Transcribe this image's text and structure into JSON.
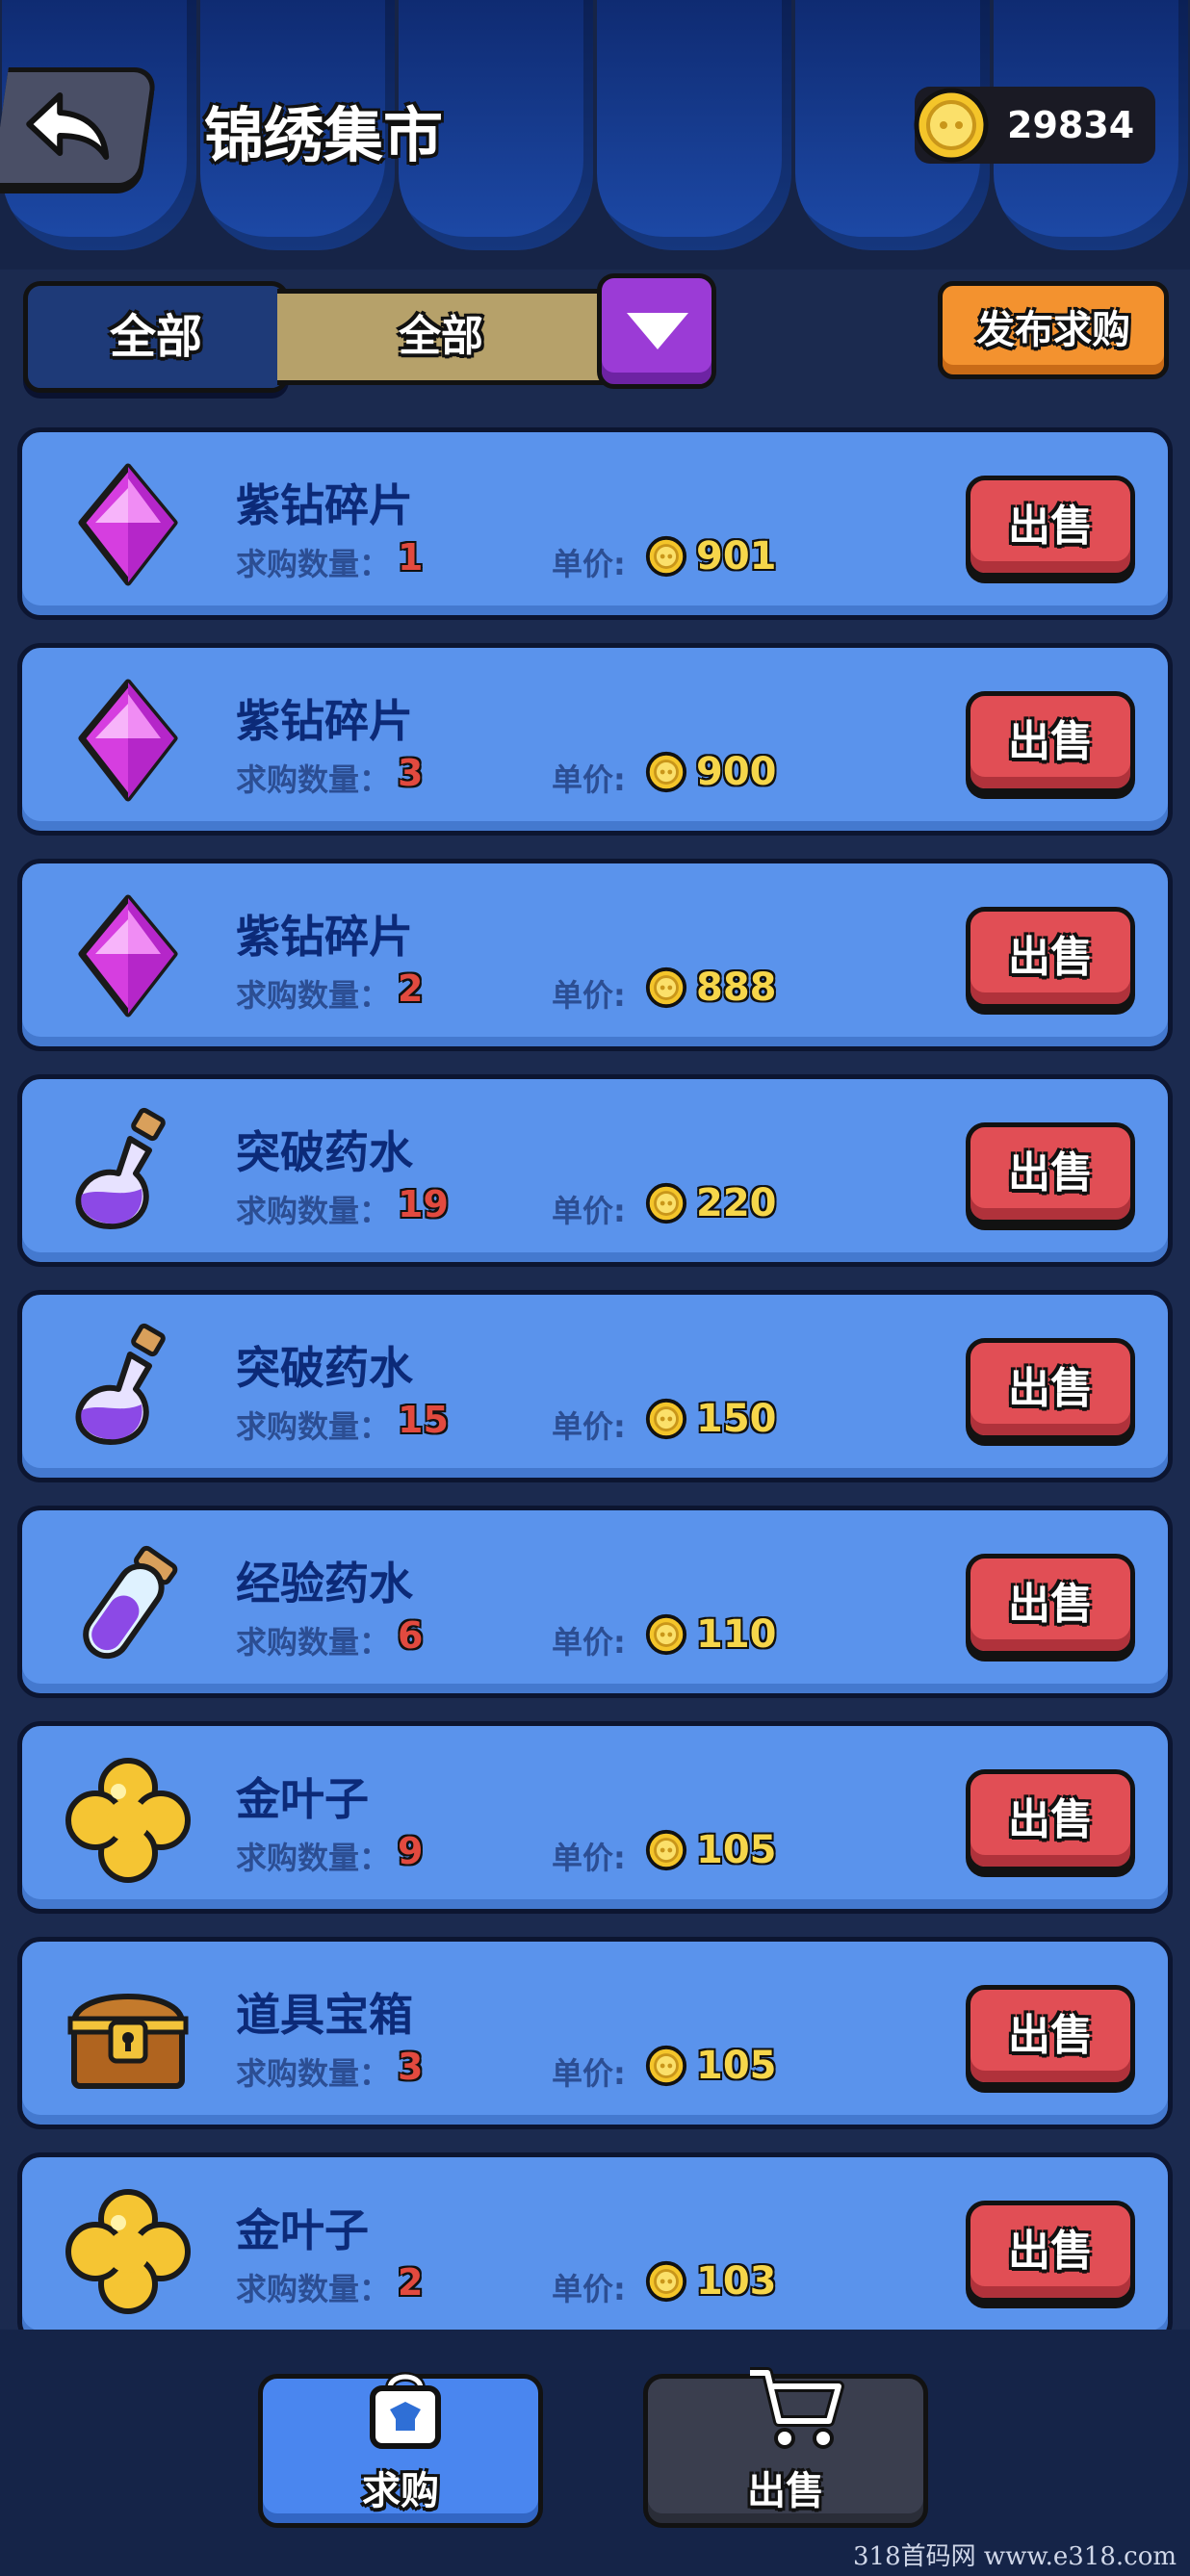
{
  "header": {
    "title": "锦绣集市",
    "coins": "29834"
  },
  "filter": {
    "category": "全部",
    "subcategory": "全部",
    "publish_label": "发布求购"
  },
  "labels": {
    "quantity": "求购数量：",
    "price": "单价:",
    "sell": "出售"
  },
  "items": [
    {
      "name": "紫钻碎片",
      "qty": "1",
      "price": "901",
      "icon": "purple-diamond"
    },
    {
      "name": "紫钻碎片",
      "qty": "3",
      "price": "900",
      "icon": "purple-diamond"
    },
    {
      "name": "紫钻碎片",
      "qty": "2",
      "price": "888",
      "icon": "purple-diamond"
    },
    {
      "name": "突破药水",
      "qty": "19",
      "price": "220",
      "icon": "potion-flask"
    },
    {
      "name": "突破药水",
      "qty": "15",
      "price": "150",
      "icon": "potion-flask"
    },
    {
      "name": "经验药水",
      "qty": "6",
      "price": "110",
      "icon": "potion-tube"
    },
    {
      "name": "金叶子",
      "qty": "9",
      "price": "105",
      "icon": "golden-clover"
    },
    {
      "name": "道具宝箱",
      "qty": "3",
      "price": "105",
      "icon": "treasure-chest"
    },
    {
      "name": "金叶子",
      "qty": "2",
      "price": "103",
      "icon": "golden-clover"
    }
  ],
  "tabs": {
    "buy": "求购",
    "sell": "出售"
  },
  "watermark": "318首码网 www.e318.com",
  "colors": {
    "card": "#5a93ec",
    "sell_button": "#e14e55",
    "publish_button": "#f3922f",
    "coin": "#f6d64a"
  }
}
